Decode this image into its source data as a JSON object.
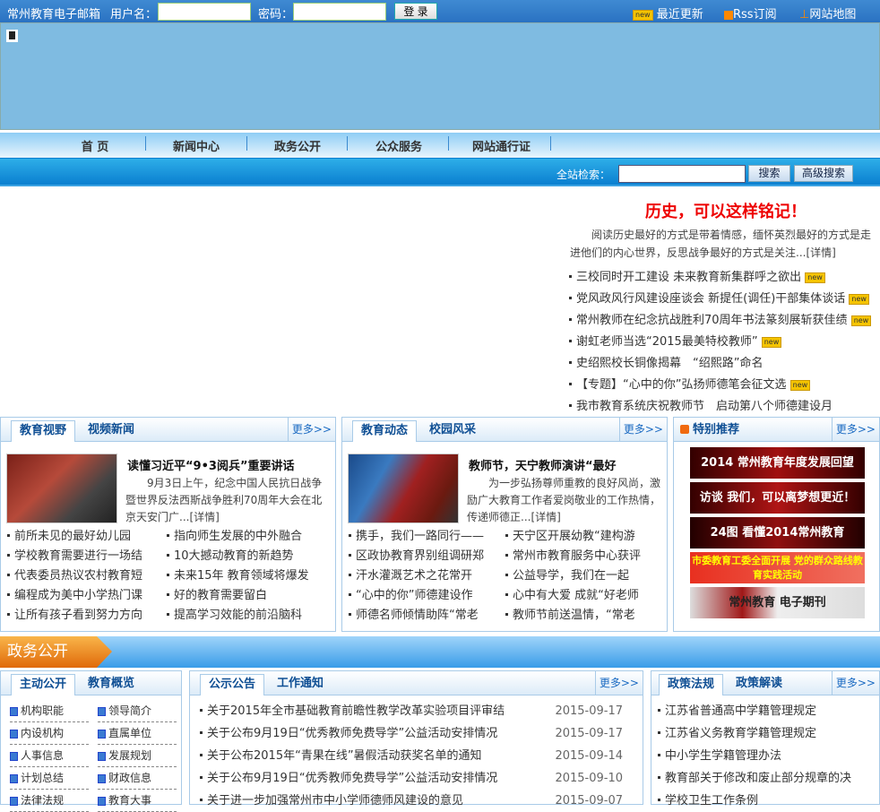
{
  "topbar": {
    "mail_label": "常州教育电子邮箱",
    "user_label": "用户名：",
    "pwd_label": "密码：",
    "login": "登 录",
    "recent": "最近更新",
    "rss": "Rss订阅",
    "sitemap": "网站地图",
    "new_badge": "new"
  },
  "nav": [
    "首 页",
    "新闻中心",
    "政务公开",
    "公众服务",
    "网站通行证"
  ],
  "search": {
    "label": "全站检索：",
    "button": "搜索",
    "advanced": "高级搜索"
  },
  "headline": {
    "title": "历史，可以这样铭记！",
    "summary": "阅读历史最好的方式是带着情感，缅怀英烈最好的方式是走进他们的内心世界，反思战争最好的方式是关注...[详情]"
  },
  "top_news": [
    {
      "t": "三校同时开工建设 未来教育新集群呼之欲出",
      "new": true
    },
    {
      "t": "党风政风行风建设座谈会 新提任(调任)干部集体谈话",
      "new": true
    },
    {
      "t": "常州教师在纪念抗战胜利70周年书法篆刻展斩获佳绩",
      "new": true
    },
    {
      "t": "谢虹老师当选“2015最美特校教师”",
      "new": true
    },
    {
      "t": "史绍熙校长铜像揭幕　“绍熙路”命名",
      "new": false
    },
    {
      "t": "【专题】“心中的你”弘扬师德笔会征文选",
      "new": true
    },
    {
      "t": "我市教育系统庆祝教师节　启动第八个师德建设月",
      "new": false
    }
  ],
  "more": "更多>>",
  "panel1": {
    "tabs": [
      "教育视野",
      "视频新闻"
    ],
    "title": "读懂习近平“9•3阅兵”重要讲话",
    "summary": "9月3日上午，纪念中国人民抗日战争暨世界反法西斯战争胜利70周年大会在北京天安门广...[详情]",
    "items": [
      "前所未见的最好幼儿园",
      "指向师生发展的中外融合",
      "学校教育需要进行一场结",
      "10大撼动教育的新趋势",
      "代表委员热议农村教育短",
      "未来15年 教育领域将爆发",
      "编程成为美中小学热门课",
      "好的教育需要留白",
      "让所有孩子看到努力方向",
      "提高学习效能的前沿脑科"
    ]
  },
  "panel2": {
    "tabs": [
      "教育动态",
      "校园风采"
    ],
    "title": "教师节，天宁教师演讲“最好",
    "summary": "为一步弘扬尊师重教的良好风尚，激励广大教育工作者爱岗敬业的工作热情，传递师德正...[详情]",
    "items": [
      "携手，我们一路同行——",
      "天宁区开展幼教“建构游",
      "区政协教育界别组调研郑",
      "常州市教育服务中心获评",
      "汗水灌溉艺术之花常开",
      "公益导学，我们在一起",
      "“心中的你”师德建设作",
      "心中有大爱 成就“好老师",
      "师德名师倾情助阵“常老",
      "教师节前送温情，“常老"
    ]
  },
  "panel3": {
    "title": "特别推荐",
    "ads": [
      "2014 常州教育年度发展回望",
      "访谈 我们，可以离梦想更近！",
      "24图 看懂2014常州教育",
      "市委教育工委全面开展 党的群众路线教育实践活动",
      "常州教育 电子期刊"
    ]
  },
  "zw": {
    "title": "政务公开"
  },
  "zw1": {
    "tabs": [
      "主动公开",
      "教育概览"
    ],
    "items": [
      "机构职能",
      "领导简介",
      "内设机构",
      "直属单位",
      "人事信息",
      "发展规划",
      "计划总结",
      "财政信息",
      "法律法规",
      "教育大事"
    ]
  },
  "zw2": {
    "tabs": [
      "公示公告",
      "工作通知"
    ],
    "items": [
      {
        "t": "关于2015年全市基础教育前瞻性教学改革实验项目评审结",
        "d": "2015-09-17"
      },
      {
        "t": "关于公布9月19日“优秀教师免费导学”公益活动安排情况",
        "d": "2015-09-17"
      },
      {
        "t": "关于公布2015年“青果在线”暑假活动获奖名单的通知",
        "d": "2015-09-14"
      },
      {
        "t": "关于公布9月19日“优秀教师免费导学”公益活动安排情况",
        "d": "2015-09-10"
      },
      {
        "t": "关于进一步加强常州市中小学师德师风建设的意见",
        "d": "2015-09-07"
      }
    ]
  },
  "zw3": {
    "tabs": [
      "政策法规",
      "政策解读"
    ],
    "items": [
      "江苏省普通高中学籍管理规定",
      "江苏省义务教育学籍管理规定",
      "中小学生学籍管理办法",
      "教育部关于修改和废止部分规章的决",
      "学校卫生工作条例"
    ]
  }
}
